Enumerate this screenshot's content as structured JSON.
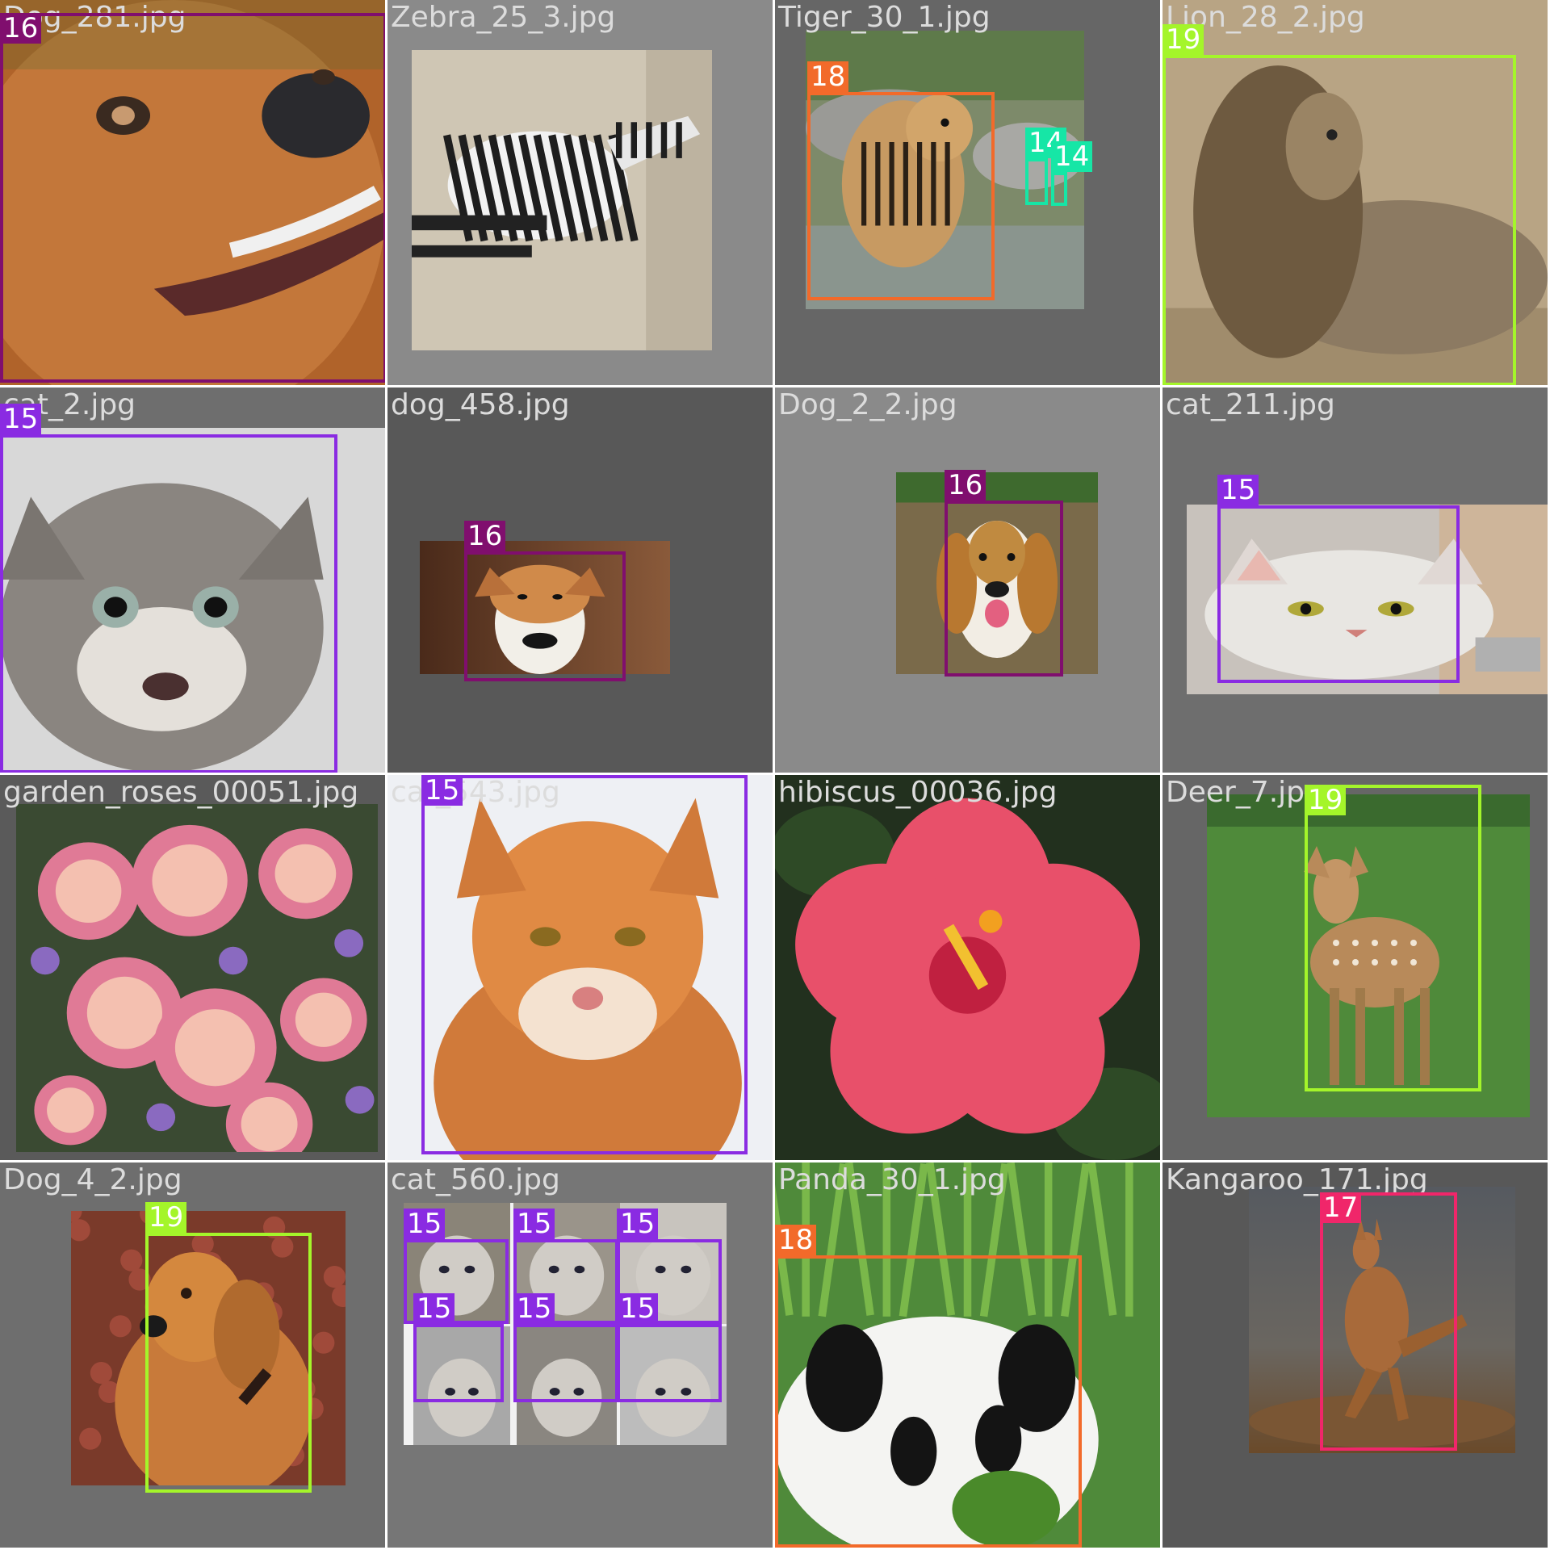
{
  "colors": {
    "class_14": "#16e6a6",
    "class_15": "#8a2be2",
    "class_16": "#800e6e",
    "class_17": "#f0266a",
    "class_18": "#f26a2a",
    "class_19": "#a4f52a"
  },
  "tiles": [
    {
      "filename": "Dog_281.jpg",
      "bg": "#8a8a8a",
      "photo": "dog-face",
      "boxes": [
        {
          "label": "16",
          "cls": 16
        }
      ]
    },
    {
      "filename": "Zebra_25_3.jpg",
      "bg": "#8a8a8a",
      "photo": "zebra",
      "boxes": []
    },
    {
      "filename": "Tiger_30_1.jpg",
      "bg": "#666666",
      "photo": "tiger",
      "boxes": [
        {
          "label": "18",
          "cls": 18
        },
        {
          "label": "14",
          "cls": 14
        },
        {
          "label": "14",
          "cls": 14
        }
      ]
    },
    {
      "filename": "Lion_28_2.jpg",
      "bg": "#8a8a8a",
      "photo": "lion",
      "boxes": [
        {
          "label": "19",
          "cls": 19
        }
      ]
    },
    {
      "filename": "cat_2.jpg",
      "bg": "#6e6e6e",
      "photo": "kitten",
      "boxes": [
        {
          "label": "15",
          "cls": 15
        }
      ]
    },
    {
      "filename": "dog_458.jpg",
      "bg": "#585858",
      "photo": "terrier",
      "boxes": [
        {
          "label": "16",
          "cls": 16
        }
      ]
    },
    {
      "filename": "Dog_2_2.jpg",
      "bg": "#8a8a8a",
      "photo": "beagle",
      "boxes": [
        {
          "label": "16",
          "cls": 16
        }
      ]
    },
    {
      "filename": "cat_211.jpg",
      "bg": "#6e6e6e",
      "photo": "white-cat",
      "boxes": [
        {
          "label": "15",
          "cls": 15
        }
      ]
    },
    {
      "filename": "garden_roses_00051.jpg",
      "bg": "#5a5a5a",
      "photo": "roses",
      "boxes": []
    },
    {
      "filename": "cat_543.jpg",
      "bg": "#f0f2f5",
      "photo": "orange-cat",
      "boxes": [
        {
          "label": "15",
          "cls": 15
        }
      ]
    },
    {
      "filename": "hibiscus_00036.jpg",
      "bg": "#2e3d2a",
      "photo": "hibiscus",
      "boxes": []
    },
    {
      "filename": "Deer_7.jpeg",
      "bg": "#666666",
      "photo": "deer",
      "boxes": [
        {
          "label": "19",
          "cls": 19
        }
      ]
    },
    {
      "filename": "Dog_4_2.jpg",
      "bg": "#6e6e6e",
      "photo": "golden",
      "boxes": [
        {
          "label": "19",
          "cls": 19
        }
      ]
    },
    {
      "filename": "cat_560.jpg",
      "bg": "#767676",
      "photo": "cat-collage",
      "boxes": [
        {
          "label": "15",
          "cls": 15
        },
        {
          "label": "15",
          "cls": 15
        },
        {
          "label": "15",
          "cls": 15
        },
        {
          "label": "15",
          "cls": 15
        },
        {
          "label": "15",
          "cls": 15
        },
        {
          "label": "15",
          "cls": 15
        }
      ]
    },
    {
      "filename": "Panda_30_1.jpg",
      "bg": "#4f8a3a",
      "photo": "panda",
      "boxes": [
        {
          "label": "18",
          "cls": 18
        }
      ]
    },
    {
      "filename": "Kangaroo_171.jpg",
      "bg": "#585858",
      "photo": "kangaroo",
      "boxes": [
        {
          "label": "17",
          "cls": 17
        }
      ]
    }
  ]
}
